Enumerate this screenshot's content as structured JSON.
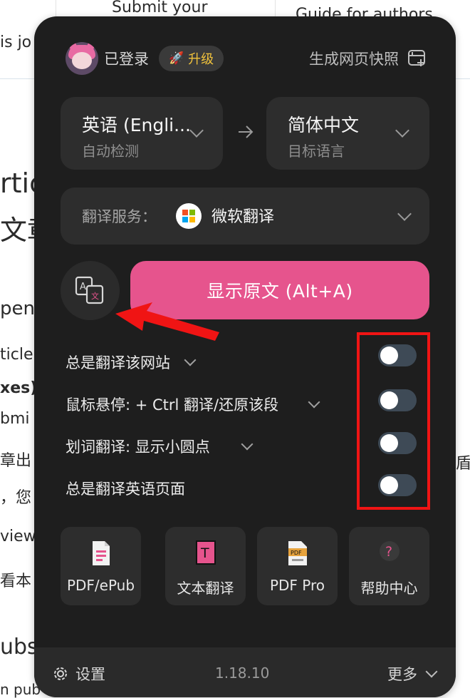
{
  "background_page": {
    "fragments": [
      {
        "text": "Submit your"
      },
      {
        "text": "Guide for authors"
      },
      {
        "text": "is jo"
      },
      {
        "text": "rtic"
      },
      {
        "text": "文章"
      },
      {
        "text": "pen"
      },
      {
        "text": "ticle"
      },
      {
        "text": "xes)."
      },
      {
        "text": "bmi"
      },
      {
        "text": "章出"
      },
      {
        "text": "，您"
      },
      {
        "text": "view"
      },
      {
        "text": "看本"
      },
      {
        "text": "ubsc"
      },
      {
        "text": "n pub"
      },
      {
        "text": "盾"
      }
    ]
  },
  "popup": {
    "header": {
      "logged_in_label": "已登录",
      "upgrade_label": "升级",
      "snapshot_label": "生成网页快照"
    },
    "source_language": {
      "name": "英语 (Engli...",
      "sub": "自动检测"
    },
    "target_language": {
      "name": "简体中文",
      "sub": "目标语言"
    },
    "translation_service": {
      "label": "翻译服务：",
      "name": "微软翻译"
    },
    "show_original_button": "显示原文 (Alt+A)",
    "options": [
      {
        "label": "总是翻译该网站",
        "has_dropdown": true,
        "enabled": false
      },
      {
        "label": "鼠标悬停:  + Ctrl 翻译/还原该段",
        "has_dropdown": true,
        "enabled": false
      },
      {
        "label": "划词翻译:  显示小圆点",
        "has_dropdown": true,
        "enabled": false
      },
      {
        "label": "总是翻译英语页面",
        "has_dropdown": false,
        "enabled": false
      }
    ],
    "tools": [
      {
        "label": "PDF/ePub",
        "icon": "pdf-epub-icon"
      },
      {
        "label": "文本翻译",
        "icon": "text-translate-icon"
      },
      {
        "label": "PDF Pro",
        "icon": "pdf-pro-icon"
      },
      {
        "label": "帮助中心",
        "icon": "help-icon"
      }
    ],
    "footer": {
      "settings_label": "设置",
      "version": "1.18.10",
      "more_label": "更多"
    }
  },
  "colors": {
    "popup_bg": "#1e1e1e",
    "card_bg": "#2d2d2d",
    "accent_pink": "#e6548d",
    "upgrade_gold": "#f0c23c",
    "annotation_red": "#f01414"
  }
}
